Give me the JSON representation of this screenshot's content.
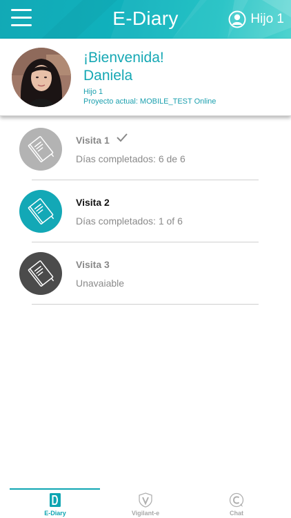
{
  "header": {
    "title": "E-Diary",
    "user_name": "Hijo 1"
  },
  "profile": {
    "greeting": "¡Bienvenida!",
    "name": "Daniela",
    "child": "Hijo 1",
    "project": "Proyecto actual: MOBILE_TEST Online"
  },
  "visits": [
    {
      "title": "Visita 1",
      "subtitle": "Días completados: 6 de 6",
      "status": "completed"
    },
    {
      "title": "Visita 2",
      "subtitle": "Días completados: 1 of 6",
      "status": "active"
    },
    {
      "title": "Visita 3",
      "subtitle": "Unavaiable",
      "status": "unavailable"
    }
  ],
  "tabs": [
    {
      "label": "E-Diary",
      "icon": "diary-icon",
      "active": true
    },
    {
      "label": "Vigilant-e",
      "icon": "vigilant-icon",
      "active": false
    },
    {
      "label": "Chat",
      "icon": "chat-icon",
      "active": false
    }
  ],
  "colors": {
    "accent": "#12a9b6",
    "completed": "#b3b3b3",
    "active": "#13a8b6",
    "unavailable": "#4b4b4b"
  }
}
